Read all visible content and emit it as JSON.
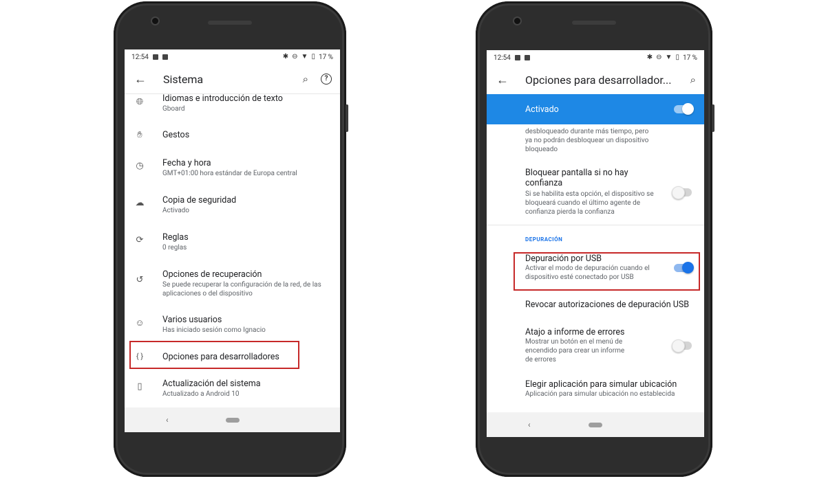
{
  "left": {
    "status": {
      "time": "12:54",
      "battery": "17 %"
    },
    "appbar": {
      "title": "Sistema"
    },
    "items": [
      {
        "title": "Idiomas e introducción de texto",
        "sub": "Gboard",
        "icon": "globe-icon"
      },
      {
        "title": "Gestos",
        "sub": "",
        "icon": "gestures-icon"
      },
      {
        "title": "Fecha y hora",
        "sub": "GMT+01:00 hora estándar de Europa central",
        "icon": "clock-icon"
      },
      {
        "title": "Copia de seguridad",
        "sub": "Activado",
        "icon": "cloud-upload-icon"
      },
      {
        "title": "Reglas",
        "sub": "0 reglas",
        "icon": "rules-icon"
      },
      {
        "title": "Opciones de recuperación",
        "sub": "Se puede recuperar la configuración de la red, de las aplicaciones o del dispositivo",
        "icon": "history-icon"
      },
      {
        "title": "Varios usuarios",
        "sub": "Has iniciado sesión como Ignacio",
        "icon": "person-icon"
      },
      {
        "title": "Opciones para desarrolladores",
        "sub": "",
        "icon": "braces-icon"
      },
      {
        "title": "Actualización del sistema",
        "sub": "Actualizado a Android 10",
        "icon": "system-update-icon"
      }
    ]
  },
  "right": {
    "status": {
      "time": "12:54",
      "battery": "17 %"
    },
    "appbar": {
      "title": "Opciones para desarrollador..."
    },
    "master": {
      "label": "Activado",
      "state": "on"
    },
    "partial_text": "desbloqueado durante más tiempo, pero ya no podrán desbloquear un dispositivo bloqueado",
    "lock_item": {
      "title": "Bloquear pantalla si no hay confianza",
      "sub": "Si se habilita esta opción, el dispositivo se bloqueará cuando el último agente de confianza pierda la confianza",
      "state": "off"
    },
    "section_header": "DEPURACIÓN",
    "usb_item": {
      "title": "Depuración por USB",
      "sub": "Activar el modo de depuración cuando el dispositivo esté conectado por USB",
      "state": "on"
    },
    "revoke_item": {
      "title": "Revocar autorizaciones de depuración USB"
    },
    "bugreport_item": {
      "title": "Atajo a informe de errores",
      "sub": "Mostrar un botón en el menú de encendido para crear un informe de errores",
      "state": "off"
    },
    "mock_location_item": {
      "title": "Elegir aplicación para simular ubicación",
      "sub": "Aplicación para simular ubicación no establecida"
    }
  },
  "colors": {
    "accent": "#1e88e5",
    "highlight": "#c62828",
    "phone_body": "#2d2d2d"
  }
}
